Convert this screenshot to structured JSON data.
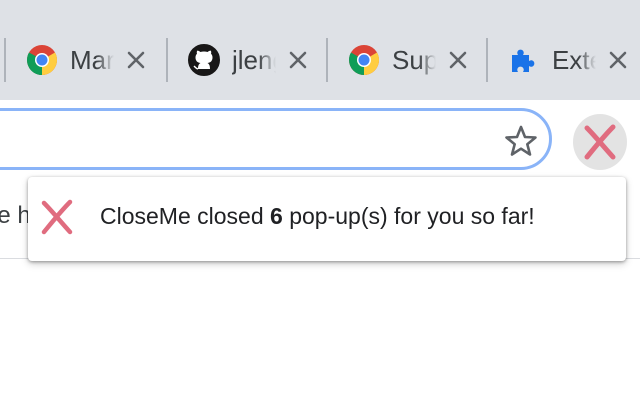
{
  "tabs": [
    {
      "label": "Mar",
      "icon": "chrome-icon"
    },
    {
      "label": "jleng",
      "icon": "github-icon"
    },
    {
      "label": "Sup",
      "icon": "chrome-icon"
    },
    {
      "label": "Exte",
      "icon": "puzzle-icon"
    }
  ],
  "toolbar": {
    "address_value": "",
    "extension_name": "CloseMe"
  },
  "bookmarks": {
    "partial_text": "le h"
  },
  "popup": {
    "text_before": "CloseMe closed ",
    "count": "6",
    "text_after": " pop-up(s) for you so far!"
  },
  "colors": {
    "tabstrip_bg": "#dee1e6",
    "omnibox_border": "#8ab4f8",
    "closeme_x": "#e06c7f",
    "puzzle_blue": "#1a73e8"
  }
}
